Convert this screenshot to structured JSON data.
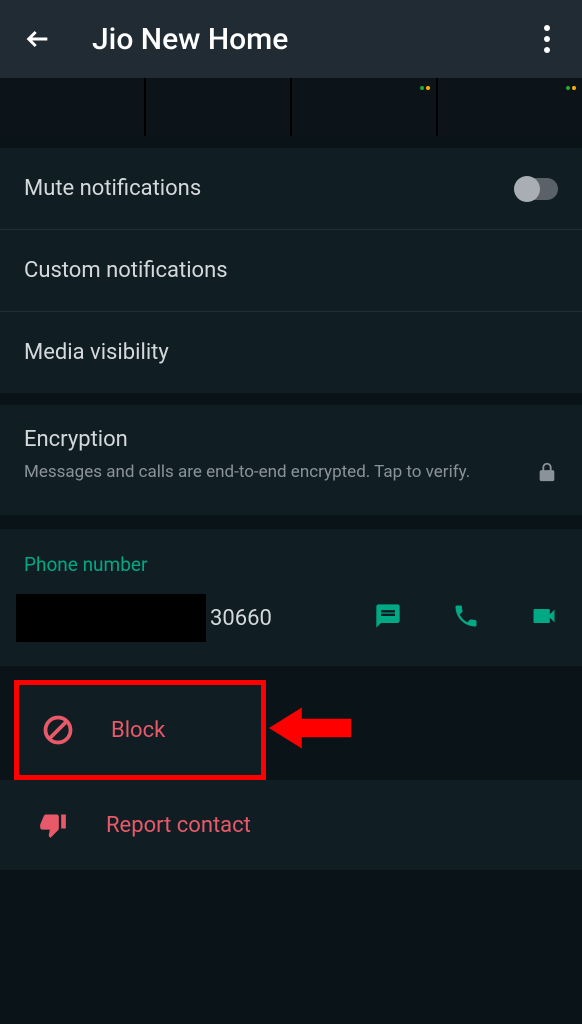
{
  "header": {
    "title": "Jio New Home"
  },
  "settings": {
    "mute_label": "Mute notifications",
    "custom_label": "Custom notifications",
    "media_label": "Media visibility"
  },
  "encryption": {
    "title": "Encryption",
    "description": "Messages and calls are end-to-end encrypted. Tap to verify."
  },
  "phone": {
    "label": "Phone number",
    "number_suffix": "30660"
  },
  "actions": {
    "block_label": "Block",
    "report_label": "Report contact"
  }
}
